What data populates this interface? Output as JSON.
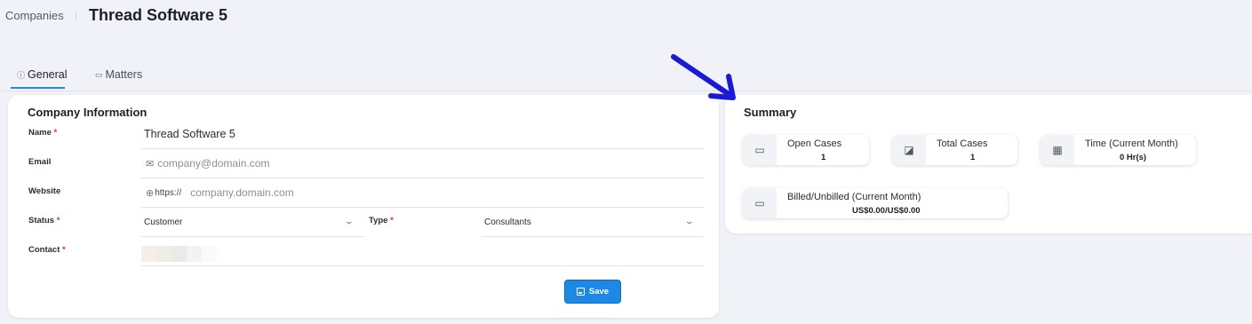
{
  "header": {
    "breadcrumb": "Companies",
    "title": "Thread Software 5"
  },
  "tabs": [
    {
      "label": "General",
      "icon": "info-icon",
      "active": true
    },
    {
      "label": "Matters",
      "icon": "folder-icon",
      "active": false
    }
  ],
  "company": {
    "title": "Company Information",
    "name_label": "Name",
    "name_value": "Thread Software 5",
    "email_label": "Email",
    "email_placeholder": "company@domain.com",
    "website_label": "Website",
    "website_prefix": "https://",
    "website_placeholder": "company.domain.com",
    "status_label": "Status",
    "status_value": "Customer",
    "type_label": "Type",
    "type_value": "Consultants",
    "contact_label": "Contact",
    "required_mark": "*",
    "save_label": "Save"
  },
  "summary": {
    "title": "Summary",
    "stats": [
      {
        "label": "Open Cases",
        "value": "1",
        "icon": "cases-icon"
      },
      {
        "label": "Total Cases",
        "value": "1",
        "icon": "total-cases-icon"
      },
      {
        "label": "Time (Current Month)",
        "value": "0 Hr(s)",
        "icon": "calendar-clock-icon"
      },
      {
        "label": "Billed/Unbilled (Current Month)",
        "value": "US$0.00/US$0.00",
        "icon": "card-icon"
      }
    ]
  },
  "colors": {
    "accent": "#1e88e5",
    "required": "#e0322b",
    "annotation_arrow": "#1a1ad6"
  }
}
